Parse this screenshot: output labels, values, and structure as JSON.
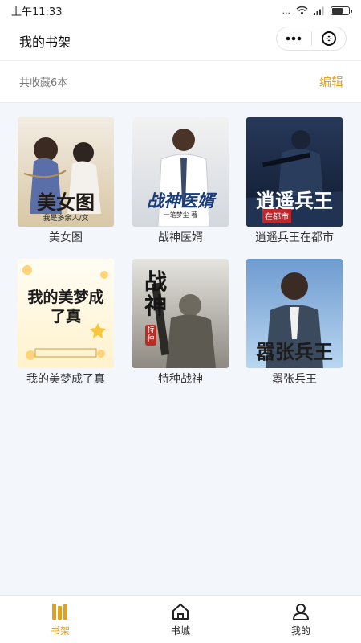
{
  "status_bar": {
    "time": "上午11:33",
    "network_speed": "...",
    "signal": "..ıl"
  },
  "nav": {
    "title": "我的书架"
  },
  "toolbar": {
    "count_text": "共收藏6本",
    "edit_label": "编辑"
  },
  "books": [
    {
      "title": "美女图",
      "cover_text": "美女图",
      "cover_sub": "我是多余人/文",
      "colors": [
        "#efe6d8",
        "#d6c4a0"
      ]
    },
    {
      "title": "战神医婿",
      "cover_text": "战神医婿",
      "cover_sub": "一笔梦尘 著",
      "colors": [
        "#eeeeee",
        "#cfd4db"
      ]
    },
    {
      "title": "逍遥兵王在都市",
      "cover_text": "逍遥兵王",
      "cover_sub": "在都市",
      "colors": [
        "#1a2a44",
        "#3f5b86"
      ]
    },
    {
      "title": "我的美梦成了真",
      "cover_text": "我的美梦成了真",
      "cover_sub": "",
      "colors": [
        "#fffdf2",
        "#fff1c4"
      ]
    },
    {
      "title": "特种战神",
      "cover_text": "战神",
      "cover_sub": "特种",
      "colors": [
        "#d9d7d2",
        "#8f8b83"
      ]
    },
    {
      "title": "嚣张兵王",
      "cover_text": "嚣张兵王",
      "cover_sub": "",
      "colors": [
        "#4f7fb8",
        "#9cc3e6"
      ]
    }
  ],
  "tabs": [
    {
      "label": "书架",
      "icon": "bookshelf-icon",
      "active": true
    },
    {
      "label": "书城",
      "icon": "home-icon",
      "active": false
    },
    {
      "label": "我的",
      "icon": "user-icon",
      "active": false
    }
  ],
  "accent_color": "#e0a020"
}
